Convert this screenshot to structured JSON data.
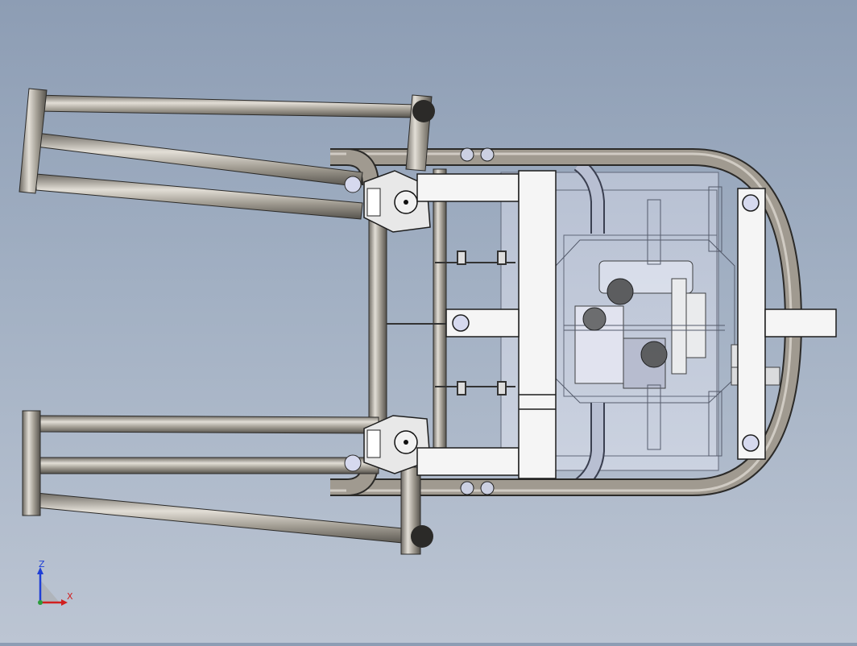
{
  "viewport": {
    "background_top": "#8d9db4",
    "background_bottom": "#bcc5d3",
    "model": {
      "tube_color": "#8f8a80",
      "tube_highlight": "#d6d2ca",
      "tube_outline": "#2b2a28",
      "plate_color": "#f4f4f4",
      "plate_outline": "#1d1d1d",
      "transparent_part_color": "#c9d1e2",
      "wire_color": "#4c5262"
    }
  },
  "triad": {
    "z_label": "Z",
    "x_label": "X",
    "z_color": "#1f3fd6",
    "x_color": "#d11f1f",
    "y_color": "#2a9d3a",
    "icon": "view-orientation-triad-icon"
  }
}
